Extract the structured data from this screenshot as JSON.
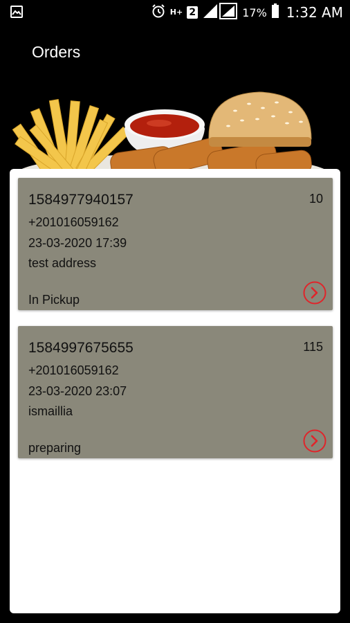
{
  "status_bar": {
    "network_type": "H+",
    "sim_slot": "2",
    "battery_percent": "17%",
    "time": "1:32 AM",
    "icons": [
      "gallery-notification-icon",
      "alarm-icon",
      "signal-icon",
      "battery-icon"
    ]
  },
  "toolbar": {
    "title": "Orders"
  },
  "colors": {
    "card_background": "#8a887a",
    "arrow_accent": "#e0242a",
    "panel_background": "#ffffff",
    "app_background": "#000000"
  },
  "orders": [
    {
      "id": "1584977940157",
      "quantity": "10",
      "phone": "+201016059162",
      "date": "23-03-2020 17:39",
      "address": "test address",
      "status": "In Pickup"
    },
    {
      "id": "1584997675655",
      "quantity": "115",
      "phone": "+201016059162",
      "date": "23-03-2020 23:07",
      "address": "ismaillia",
      "status": "preparing"
    }
  ]
}
